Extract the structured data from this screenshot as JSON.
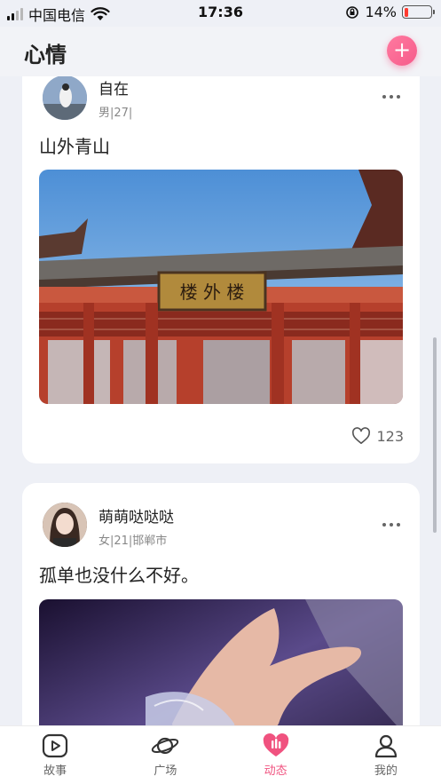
{
  "status_bar": {
    "carrier": "中国电信",
    "time": "17:36",
    "battery": "14%",
    "battery_level": 0.14
  },
  "header": {
    "title": "心情",
    "add_label": "+"
  },
  "posts": [
    {
      "username": "自在",
      "meta": "男|27|",
      "text": "山外青山",
      "likes": "123"
    },
    {
      "username": "萌萌哒哒哒",
      "meta": "女|21|邯郸市",
      "text": "孤单也没什么不好。"
    }
  ],
  "tabbar": {
    "tabs": [
      {
        "label": "故事",
        "icon": "play-icon",
        "active": false
      },
      {
        "label": "广场",
        "icon": "planet-icon",
        "active": false
      },
      {
        "label": "动态",
        "icon": "dynamic-icon",
        "active": true
      },
      {
        "label": "我的",
        "icon": "user-icon",
        "active": false
      }
    ]
  },
  "colors": {
    "accent": "#f0527f",
    "background": "#eef0f6"
  }
}
